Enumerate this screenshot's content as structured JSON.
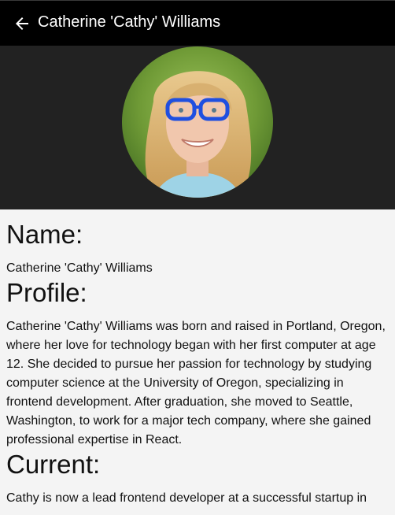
{
  "app_bar": {
    "title": "Catherine 'Cathy' Williams",
    "back_icon": "arrow-back-icon"
  },
  "profile": {
    "avatar_icon": "avatar-photo",
    "name_heading": "Name:",
    "name_value": "Catherine 'Cathy' Williams",
    "profile_heading": "Profile:",
    "profile_text": "Catherine 'Cathy' Williams was born and raised in Portland, Oregon, where her love for technology began with her first computer at age 12. She decided to pursue her passion for technology by studying computer science at the University of Oregon, specializing in frontend development. After graduation, she moved to Seattle, Washington, to work for a major tech company, where she gained professional expertise in React.",
    "current_heading": "Current:",
    "current_text": "Cathy is now a lead frontend developer at a successful startup in"
  },
  "colors": {
    "app_bar_bg": "#000000",
    "hero_bg": "#222222",
    "page_bg": "#f4f4f4",
    "glasses": "#1f4fe0"
  }
}
